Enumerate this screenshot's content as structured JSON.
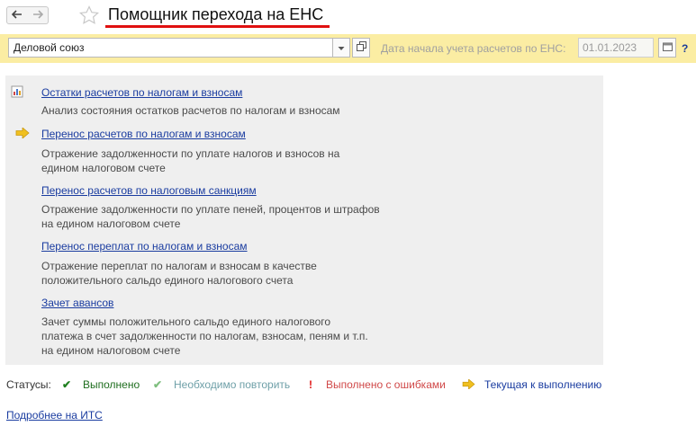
{
  "header": {
    "title": "Помощник перехода на ЕНС",
    "icons": {
      "back": "arrow-left-icon",
      "forward": "arrow-right-icon",
      "favorite": "star-outline-icon"
    }
  },
  "toolbar": {
    "organization": "Деловой союз",
    "date_label": "Дата начала учета расчетов по ЕНС:",
    "date_value": "01.01.2023",
    "help": "?"
  },
  "items": [
    {
      "title": "Остатки расчетов по налогам и взносам",
      "desc": [
        "Анализ состояния остатков расчетов по налогам и взносам"
      ],
      "icon": "report-icon"
    },
    {
      "title": "Перенос расчетов по налогам и взносам",
      "desc": [
        "Отражение задолженности по уплате налогов и взносов на",
        "едином налоговом счете"
      ],
      "icon": "current-arrow-icon"
    },
    {
      "title": "Перенос расчетов по налоговым санкциям",
      "desc": [
        "Отражение задолженности по уплате пеней, процентов и штрафов",
        "на едином налоговом счете"
      ]
    },
    {
      "title": "Перенос переплат по налогам и взносам",
      "desc": [
        "Отражение переплат по налогам и взносам в качестве",
        "положительного сальдо единого налогового счета"
      ]
    },
    {
      "title": "Зачет авансов",
      "desc": [
        "Зачет суммы положительного сальдо единого налогового",
        "платежа в счет задолженности по налогам, взносам, пеням и т.п.",
        "на едином налоговом счете"
      ]
    }
  ],
  "statuses": {
    "label": "Статусы:",
    "done": "Выполнено",
    "repeat": "Необходимо повторить",
    "error": "Выполнено с ошибками",
    "current": "Текущая к выполнению"
  },
  "its_link": "Подробнее на ИТС",
  "colors": {
    "title_underline": "#e01010",
    "toolbar_bg": "#fbeda3",
    "link": "#1a3ca0",
    "panel_bg": "#efefef"
  }
}
